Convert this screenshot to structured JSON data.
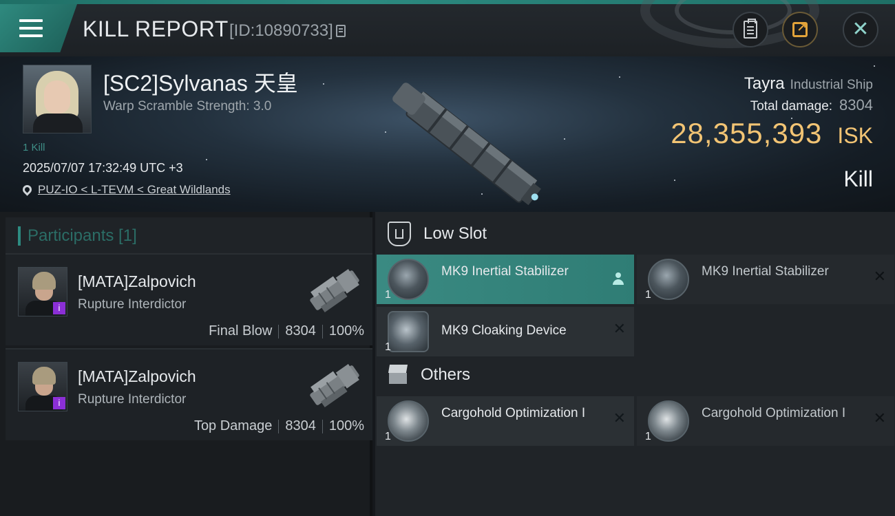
{
  "header": {
    "title": "KILL REPORT",
    "report_id": "[ID:10890733]"
  },
  "victim": {
    "name": "[SC2]Sylvanas 天皇",
    "warp_scramble": "Warp Scramble Strength: 3.0",
    "kills": "1 Kill",
    "datetime": "2025/07/07 17:32:49 UTC +3",
    "location": "PUZ-IO < L-TEVM < Great Wildlands",
    "ship_name": "Tayra",
    "ship_class": "Industrial Ship",
    "total_damage_label": "Total damage:",
    "total_damage": "8304",
    "isk_value": "28,355,393",
    "isk_unit": "ISK",
    "kill_type": "Kill"
  },
  "participants": {
    "title": "Participants [1]",
    "items": [
      {
        "name": "[MATA]Zalpovich",
        "ship": "Rupture Interdictor",
        "badge": "i",
        "role": "Final Blow",
        "damage": "8304",
        "percent": "100%"
      },
      {
        "name": "[MATA]Zalpovich",
        "ship": "Rupture Interdictor",
        "badge": "i",
        "role": "Top Damage",
        "damage": "8304",
        "percent": "100%"
      }
    ]
  },
  "sections": {
    "low_slot": {
      "title": "Low Slot",
      "modules": [
        {
          "name": "MK9 Inertial Stabilizer",
          "qty": "1",
          "status": "selected"
        },
        {
          "name": "MK9 Inertial Stabilizer",
          "qty": "1",
          "status": "destroyed"
        },
        {
          "name": "MK9 Cloaking Device",
          "qty": "1",
          "status": "destroyed"
        }
      ]
    },
    "others": {
      "title": "Others",
      "modules": [
        {
          "name": "Cargohold Optimization I",
          "qty": "1",
          "status": "destroyed"
        },
        {
          "name": "Cargohold Optimization I",
          "qty": "1",
          "status": "destroyed"
        }
      ]
    }
  },
  "icons": {
    "x": "✕"
  },
  "colors": {
    "accent": "#2d8b81",
    "isk": "#f2c474",
    "badge": "#8b2fd6"
  }
}
